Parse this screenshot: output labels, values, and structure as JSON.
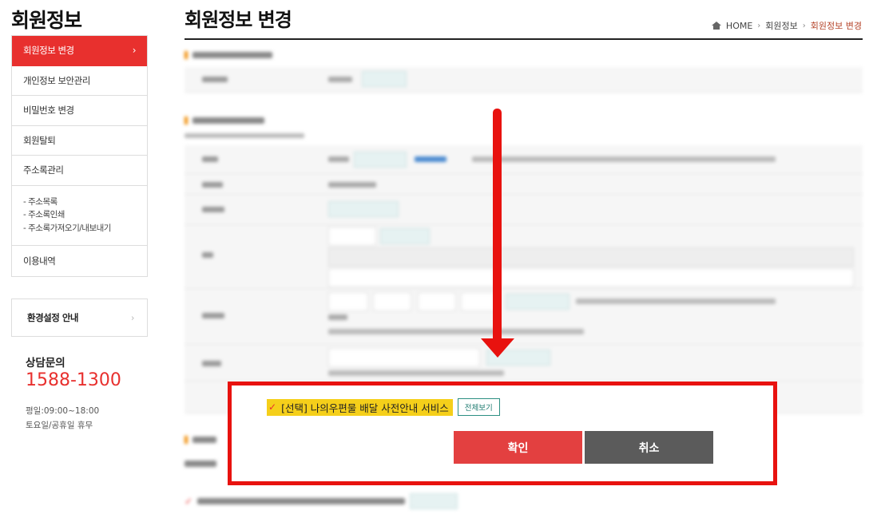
{
  "sidebar": {
    "title": "회원정보",
    "menu": [
      {
        "label": "회원정보 변경",
        "chevron": "›"
      },
      {
        "label": "개인정보 보안관리"
      },
      {
        "label": "비밀번호 변경"
      },
      {
        "label": "회원탈퇴"
      },
      {
        "label": "주소록관리"
      }
    ],
    "submenu": [
      "- 주소목록",
      "- 주소록인쇄",
      "- 주소록가져오기/내보내기"
    ],
    "last_item": "이용내역",
    "env_guide": {
      "label": "환경설정 안내",
      "chevron": "›"
    },
    "cs": {
      "title": "상담문의",
      "phone": "1588-1300",
      "hours_weekday": "평일:09:00~18:00",
      "hours_off": "토요일/공휴일 휴무"
    }
  },
  "header": {
    "title": "회원정보 변경",
    "breadcrumb": {
      "home": "HOME",
      "sep": "›",
      "parent": "회원정보",
      "current": "회원정보 변경"
    }
  },
  "dialog": {
    "option_label": "[선택] 나의우편물 배달 사전안내 서비스",
    "view_all": "전체보기",
    "confirm": "확인",
    "cancel": "취소"
  },
  "colors": {
    "accent": "#e8302e",
    "highlight": "#f5cf1a",
    "annotation": "#e8120f"
  }
}
